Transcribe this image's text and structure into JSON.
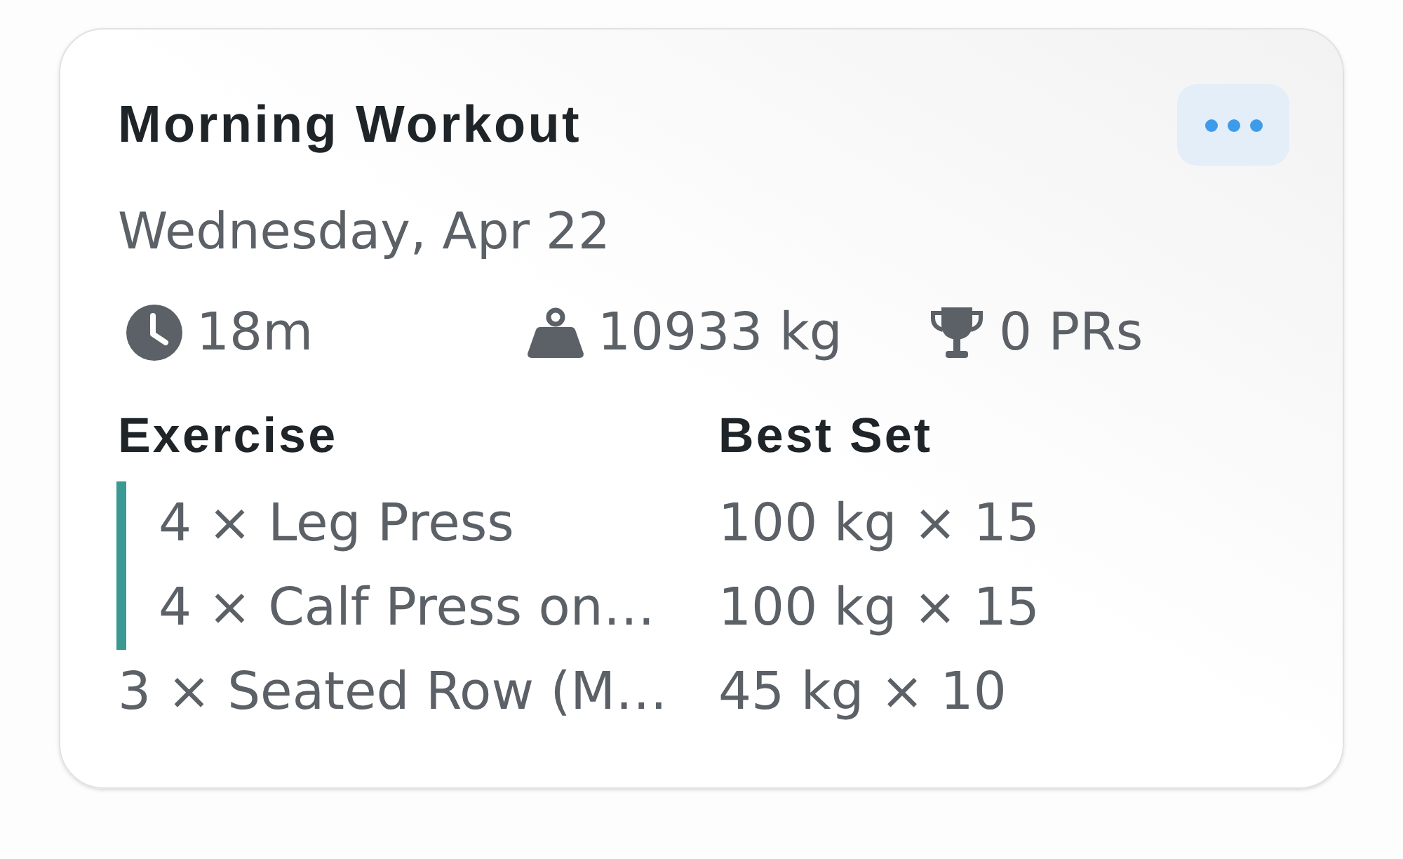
{
  "card": {
    "title": "Morning Workout",
    "date": "Wednesday, Apr 22",
    "stats": [
      {
        "kind": "duration",
        "value": "18m"
      },
      {
        "kind": "volume",
        "value": "10933 kg"
      },
      {
        "kind": "records",
        "value": "0 PRs"
      }
    ],
    "table": {
      "columns": [
        "Exercise",
        "Best Set"
      ],
      "groups": [
        {
          "kind": "superset",
          "rows": [
            {
              "exercise": "4 × Leg Press",
              "best_set": "100 kg × 15"
            },
            {
              "exercise": "4 × Calf Press on…",
              "best_set": "100 kg × 15"
            }
          ]
        },
        {
          "kind": "single",
          "rows": [
            {
              "exercise": "3 × Seated Row (M…",
              "best_set": "45 kg × 10"
            }
          ]
        }
      ]
    }
  }
}
